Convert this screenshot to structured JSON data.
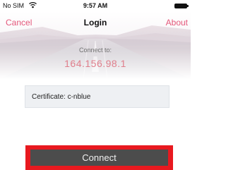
{
  "status_bar": {
    "carrier": "No SIM",
    "time": "9:57 AM"
  },
  "nav": {
    "cancel_label": "Cancel",
    "title": "Login",
    "about_label": "About"
  },
  "connection": {
    "connect_to_label": "Connect to:",
    "ip_address": "164.156.98.1",
    "certificate_label": "Certificate: c-nblue"
  },
  "actions": {
    "connect_label": "Connect"
  },
  "colors": {
    "accent": "#e4577a",
    "ip_text": "#e07f8c",
    "connect_button": "#4c4c4c",
    "highlight_frame": "#e8191f"
  },
  "icons": {
    "wifi": "wifi-icon",
    "battery": "battery-icon"
  }
}
